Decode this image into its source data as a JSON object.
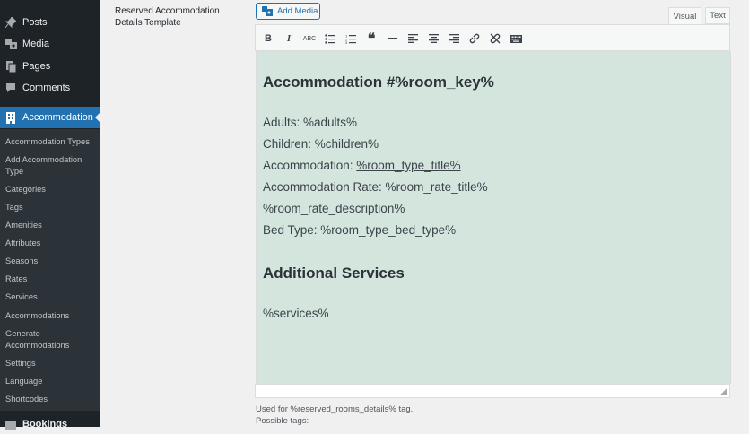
{
  "sidebar": {
    "top_items": [
      {
        "label": "Posts",
        "icon": "pin-icon"
      },
      {
        "label": "Media",
        "icon": "media-icon"
      },
      {
        "label": "Pages",
        "icon": "pages-icon"
      },
      {
        "label": "Comments",
        "icon": "comment-icon"
      },
      {
        "label": "Accommodation",
        "icon": "building-icon"
      }
    ],
    "sub_items": [
      "Accommodation Types",
      "Add Accommodation Type",
      "Categories",
      "Tags",
      "Amenities",
      "Attributes",
      "Seasons",
      "Rates",
      "Services",
      "Accommodations",
      "Generate Accommodations",
      "Settings",
      "Language",
      "Shortcodes"
    ],
    "bottom_item": "Bookings"
  },
  "field": {
    "label": "Reserved Accommodation Details Template"
  },
  "editor": {
    "add_media": "Add Media",
    "tab_visual": "Visual",
    "tab_text": "Text",
    "toolbar_icons": [
      "bold-icon",
      "italic-icon",
      "strikethrough-icon",
      "bullet-list-icon",
      "numbered-list-icon",
      "blockquote-icon",
      "horizontal-line-icon",
      "align-left-icon",
      "align-center-icon",
      "align-right-icon",
      "link-icon",
      "unlink-icon",
      "toolbar-toggle-icon"
    ],
    "heading1": "Accommodation #%room_key%",
    "lines": {
      "adults": "Adults: %adults%",
      "children": "Children: %children%",
      "accommodation_prefix": "Accommodation: ",
      "accommodation_link": "%room_type_title%",
      "rate": "Accommodation Rate: %room_rate_title%",
      "rate_description": "%room_rate_description%",
      "bed": "Bed Type: %room_type_bed_type%"
    },
    "heading2": "Additional Services",
    "services": "%services%",
    "background_color": "#d4e5de"
  },
  "help": {
    "used_for": "Used for %reserved_rooms_details% tag.",
    "possible_tags": "Possible tags:"
  },
  "colors": {
    "accent": "#2271b1",
    "sidebar": "#1d2327"
  }
}
